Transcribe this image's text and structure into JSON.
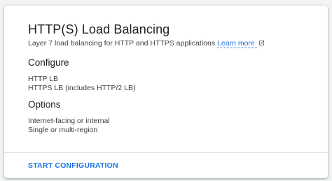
{
  "card": {
    "title": "HTTP(S) Load Balancing",
    "description": "Layer 7 load balancing for HTTP and HTTPS applications",
    "learn_more": "Learn more",
    "learn_more_icon": "open-in-new-icon",
    "configure": {
      "heading": "Configure",
      "items": [
        "HTTP LB",
        "HTTPS LB (includes HTTP/2 LB)"
      ]
    },
    "options": {
      "heading": "Options",
      "items": [
        "Internet-facing or internal",
        "Single or multi-region"
      ]
    },
    "action": "START CONFIGURATION"
  },
  "colors": {
    "accent": "#1a73e8",
    "text": "#202124",
    "secondary_text": "#3c4043",
    "divider": "#dadce0"
  }
}
